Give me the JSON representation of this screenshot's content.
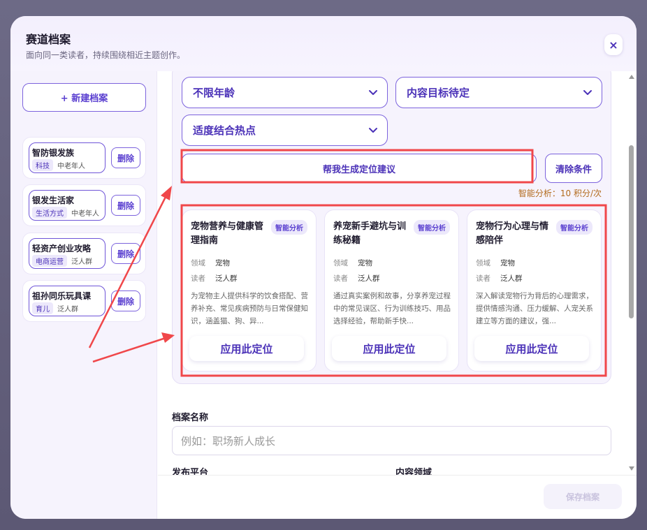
{
  "header": {
    "title": "赛道档案",
    "subtitle": "面向同一类读者，持续围绕相近主题创作。",
    "close_label": "×"
  },
  "sidebar": {
    "new_label": "+ 新建档案",
    "delete_label": "删除",
    "items": [
      {
        "name": "智防银发族",
        "tag": "科技",
        "audience": "中老年人"
      },
      {
        "name": "银发生活家",
        "tag": "生活方式",
        "audience": "中老年人"
      },
      {
        "name": "轻资产创业攻略",
        "tag": "电商运营",
        "audience": "泛人群"
      },
      {
        "name": "祖孙同乐玩具课",
        "tag": "育儿",
        "audience": "泛人群"
      }
    ]
  },
  "filters": {
    "age": "不限年龄",
    "goal": "内容目标待定",
    "hotspot": "适度结合热点"
  },
  "actions": {
    "generate_label": "帮我生成定位建议",
    "clear_label": "清除条件",
    "cost_text": "智能分析：10 积分/次"
  },
  "cards_common": {
    "badge": "智能分析",
    "domain_label": "领域",
    "reader_label": "读者",
    "apply_label": "应用此定位"
  },
  "cards": [
    {
      "title": "宠物营养与健康管理指南",
      "domain": "宠物",
      "reader": "泛人群",
      "desc": "为宠物主人提供科学的饮食搭配、营养补充、常见疾病预防与日常保健知识，涵盖猫、狗、异..."
    },
    {
      "title": "养宠新手避坑与训练秘籍",
      "domain": "宠物",
      "reader": "泛人群",
      "desc": "通过真实案例和故事，分享养宠过程中的常见误区、行为训练技巧、用品选择经验，帮助新手快..."
    },
    {
      "title": "宠物行为心理与情感陪伴",
      "domain": "宠物",
      "reader": "泛人群",
      "desc": "深入解读宠物行为背后的心理需求，提供情感沟通、压力缓解、人宠关系建立等方面的建议，强..."
    }
  ],
  "form": {
    "name_label": "档案名称",
    "name_placeholder": "例如：职场新人成长",
    "platform_label": "发布平台",
    "domain_label": "内容领域"
  },
  "footer": {
    "save_label": "保存档案"
  },
  "colors": {
    "accent": "#6f55d8",
    "annotation_red": "#f0474a",
    "cost_text": "#b26a1c"
  }
}
